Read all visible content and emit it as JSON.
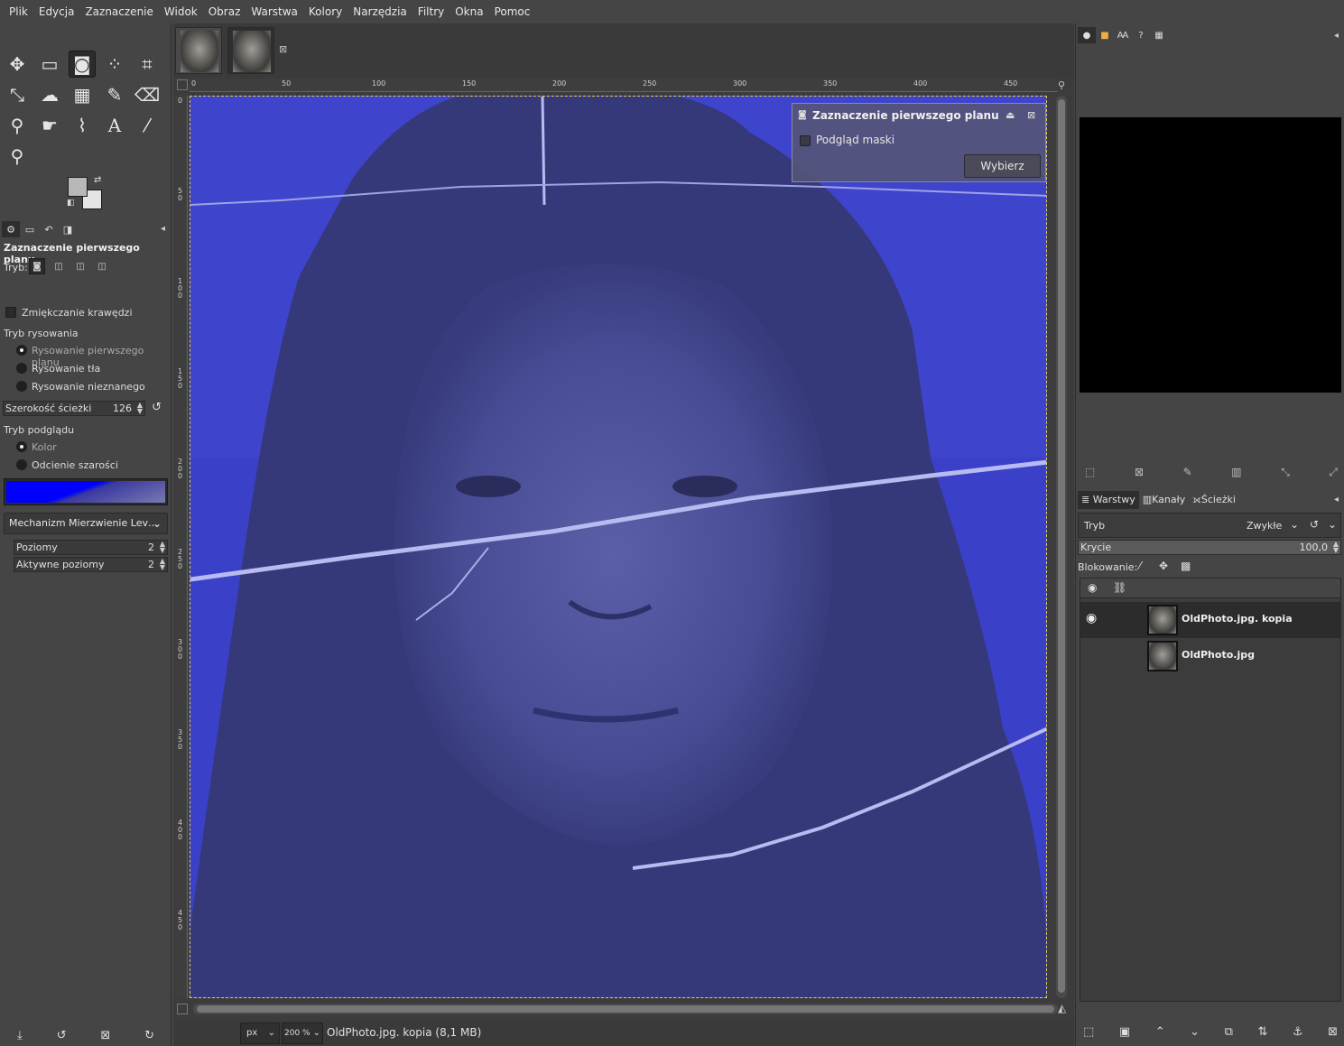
{
  "menu": [
    "Plik",
    "Edycja",
    "Zaznaczenie",
    "Widok",
    "Obraz",
    "Warstwa",
    "Kolory",
    "Narzędzia",
    "Filtry",
    "Okna",
    "Pomoc"
  ],
  "toolbox": {
    "tools": [
      {
        "name": "move-tool",
        "glyph": "✥"
      },
      {
        "name": "rect-select-tool",
        "glyph": "▭"
      },
      {
        "name": "foreground-select-tool",
        "glyph": "◙"
      },
      {
        "name": "fuzzy-select-tool",
        "glyph": "⁘"
      },
      {
        "name": "crop-tool",
        "glyph": "⌗"
      },
      {
        "name": "transform-tool",
        "glyph": "⤡"
      },
      {
        "name": "warp-tool",
        "glyph": "☁"
      },
      {
        "name": "gradient-tool",
        "glyph": "▦"
      },
      {
        "name": "paintbrush-tool",
        "glyph": "✎"
      },
      {
        "name": "eraser-tool",
        "glyph": "⌫"
      },
      {
        "name": "clone-tool",
        "glyph": "⚲"
      },
      {
        "name": "smudge-tool",
        "glyph": "☛"
      },
      {
        "name": "paths-tool",
        "glyph": "⌇"
      },
      {
        "name": "text-tool",
        "glyph": "A"
      },
      {
        "name": "color-picker-tool",
        "glyph": "⁄"
      },
      {
        "name": "zoom-tool",
        "glyph": "⚲"
      }
    ],
    "fg_color": "#b8b8b8",
    "bg_color": "#e4e4e4"
  },
  "tool_options": {
    "title": "Zaznaczenie pierwszego planu",
    "mode_label": "Tryb:",
    "feather_label": "Zmiękczanie krawędzi",
    "draw_mode_label": "Tryb rysowania",
    "draw_modes": [
      "Rysowanie pierwszego planu",
      "Rysowanie tła",
      "Rysowanie nieznanego"
    ],
    "stroke_width_label": "Szerokość ścieżki",
    "stroke_width_value": "126",
    "preview_mode_label": "Tryb podglądu",
    "preview_modes": [
      "Kolor",
      "Odcienie szarości"
    ],
    "engine": "Mechanizm Mierzwienie Lev…",
    "levels_label": "Poziomy",
    "levels_value": "2",
    "active_levels_label": "Aktywne poziomy",
    "active_levels_value": "2"
  },
  "image": {
    "ruler_h": [
      "0",
      "50",
      "100",
      "150",
      "200",
      "250",
      "300",
      "350",
      "400",
      "450"
    ],
    "ruler_v": [
      "0",
      "50",
      "100",
      "150",
      "200",
      "250",
      "300",
      "350",
      "400",
      "450"
    ],
    "dialog": {
      "title": "Zaznaczenie pierwszego planu",
      "preview_mask": "Podgląd maski",
      "select_button": "Wybierz"
    },
    "status": {
      "unit": "px",
      "zoom": "200 %",
      "text": "OldPhoto.jpg. kopia (8,1 MB)"
    }
  },
  "layers_dock": {
    "tabs": [
      "Warstwy",
      "Kanały",
      "Ścieżki"
    ],
    "mode_label": "Tryb",
    "mode_value": "Zwykłe",
    "opacity_label": "Krycie",
    "opacity_value": "100,0",
    "opacity_fraction": 1.0,
    "lock_label": "Blokowanie:",
    "layers": [
      {
        "name": "OldPhoto.jpg. kopia",
        "visible": true,
        "selected": true
      },
      {
        "name": "OldPhoto.jpg",
        "visible": false,
        "selected": false
      }
    ]
  }
}
